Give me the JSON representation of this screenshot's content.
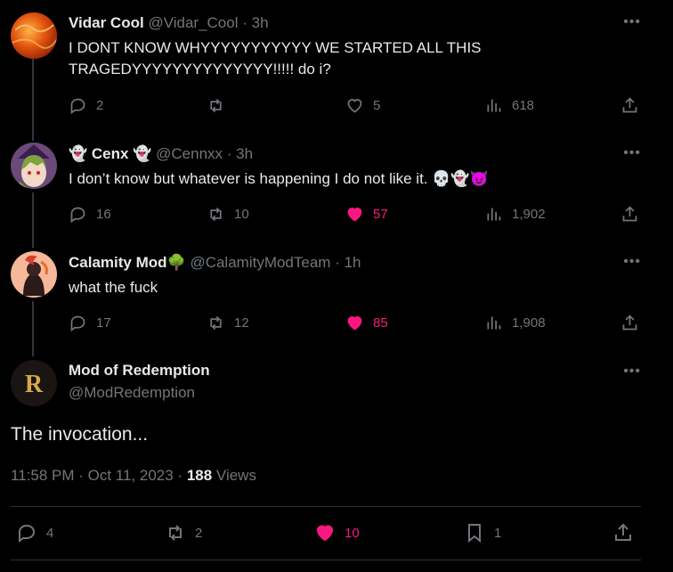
{
  "tweets": [
    {
      "name": "Vidar Cool",
      "name_prefix": "",
      "name_suffix": "",
      "handle": "@Vidar_Cool",
      "time": "· 3h",
      "text_line1": "I DONT KNOW WHYYYYYYYYYYY WE STARTED ALL THIS",
      "text_line2": "TRAGEDYYYYYYYYYYYYYY!!!!! do i?",
      "replies": "2",
      "retweets": "",
      "likes": "5",
      "views": "618",
      "liked": false
    },
    {
      "name": "Cenx",
      "name_prefix": "👻",
      "name_suffix": "👻",
      "handle": "@Cennxx",
      "time": "· 3h",
      "text_line1": "I don’t know but whatever is happening I do not like it. 💀👻😈",
      "text_line2": "",
      "replies": "16",
      "retweets": "10",
      "likes": "57",
      "views": "1,902",
      "liked": true
    },
    {
      "name": "Calamity Mod",
      "name_prefix": "",
      "name_suffix": "🌳",
      "handle": "@CalamityModTeam",
      "time": "· 1h",
      "text_line1": "what the fuck",
      "text_line2": "",
      "replies": "17",
      "retweets": "12",
      "likes": "85",
      "views": "1,908",
      "liked": true
    }
  ],
  "main_tweet": {
    "name": "Mod of Redemption",
    "handle": "@ModRedemption",
    "text": "The invocation...",
    "timestamp": "11:58 PM · Oct 11, 2023 · ",
    "views_count": "188",
    "views_label": " Views",
    "replies": "4",
    "retweets": "2",
    "likes": "10",
    "bookmarks": "1"
  },
  "more_label": "•••",
  "colors": {
    "like": "#f91880",
    "muted": "#71767b",
    "text": "#e7e9ea"
  },
  "icons": [
    "reply-icon",
    "retweet-icon",
    "heart-icon",
    "views-icon",
    "share-icon",
    "bookmark-icon",
    "more-icon"
  ]
}
